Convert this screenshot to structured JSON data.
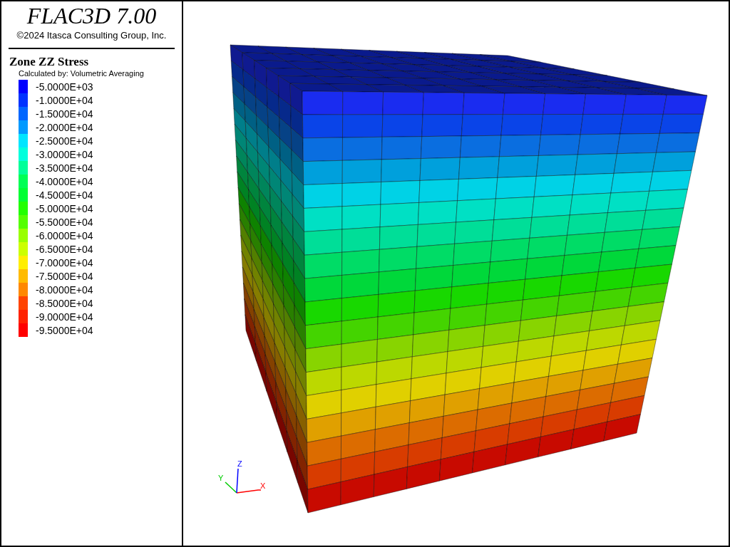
{
  "header": {
    "title": "FLAC3D 7.00",
    "copyright": "©2024 Itasca Consulting Group, Inc."
  },
  "legend": {
    "title": "Zone ZZ Stress",
    "subtitle": "Calculated by: Volumetric Averaging",
    "items": [
      {
        "label": "-5.0000E+03",
        "color": "#0000ff"
      },
      {
        "label": "-1.0000E+04",
        "color": "#0033ff"
      },
      {
        "label": "-1.5000E+04",
        "color": "#0066ff"
      },
      {
        "label": "-2.0000E+04",
        "color": "#0099ff"
      },
      {
        "label": "-2.5000E+04",
        "color": "#00e5ff"
      },
      {
        "label": "-3.0000E+04",
        "color": "#00ffdd"
      },
      {
        "label": "-3.5000E+04",
        "color": "#00ff99"
      },
      {
        "label": "-4.0000E+04",
        "color": "#00ff55"
      },
      {
        "label": "-4.5000E+04",
        "color": "#00ff33"
      },
      {
        "label": "-5.0000E+04",
        "color": "#22ff00"
      },
      {
        "label": "-5.5000E+04",
        "color": "#55ff00"
      },
      {
        "label": "-6.0000E+04",
        "color": "#99ff00"
      },
      {
        "label": "-6.5000E+04",
        "color": "#ccff00"
      },
      {
        "label": "-7.0000E+04",
        "color": "#ffee00"
      },
      {
        "label": "-7.5000E+04",
        "color": "#ffbb00"
      },
      {
        "label": "-8.0000E+04",
        "color": "#ff8800"
      },
      {
        "label": "-8.5000E+04",
        "color": "#ff4400"
      },
      {
        "label": "-9.0000E+04",
        "color": "#ff2200"
      },
      {
        "label": "-9.5000E+04",
        "color": "#ff0000"
      }
    ]
  },
  "axes": {
    "x": "X",
    "y": "Y",
    "z": "Z"
  }
}
